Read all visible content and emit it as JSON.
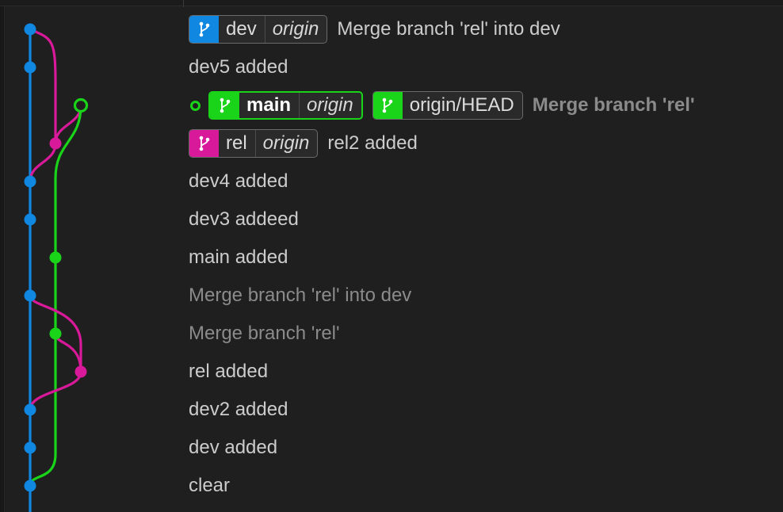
{
  "colors": {
    "dev": "#1087e0",
    "rel": "#d8199a",
    "main": "#19d419"
  },
  "icons": {
    "branch": "git-branch-icon",
    "head": "current-head-ring-icon"
  },
  "commits": [
    {
      "message": "Merge branch 'rel' into dev",
      "style": "normal",
      "refs": [
        {
          "name": "dev",
          "remote": "origin",
          "color_key": "dev"
        }
      ]
    },
    {
      "message": "dev5 added",
      "style": "normal",
      "refs": []
    },
    {
      "message": "Merge branch 'rel'",
      "style": "bold",
      "head": true,
      "refs": [
        {
          "name": "main",
          "remote": "origin",
          "color_key": "main",
          "current": true
        },
        {
          "name": "origin/HEAD",
          "color_key": "main"
        }
      ]
    },
    {
      "message": "rel2 added",
      "style": "normal",
      "refs": [
        {
          "name": "rel",
          "remote": "origin",
          "color_key": "rel"
        }
      ]
    },
    {
      "message": "dev4 added",
      "style": "normal",
      "refs": []
    },
    {
      "message": "dev3 addeed",
      "style": "normal",
      "refs": []
    },
    {
      "message": "main added",
      "style": "normal",
      "refs": []
    },
    {
      "message": "Merge branch 'rel' into dev",
      "style": "dim",
      "refs": []
    },
    {
      "message": "Merge branch 'rel'",
      "style": "dim",
      "refs": []
    },
    {
      "message": "rel added",
      "style": "normal",
      "refs": []
    },
    {
      "message": "dev2 added",
      "style": "normal",
      "refs": []
    },
    {
      "message": "dev added",
      "style": "normal",
      "refs": []
    },
    {
      "message": "clear",
      "style": "normal",
      "refs": []
    }
  ]
}
